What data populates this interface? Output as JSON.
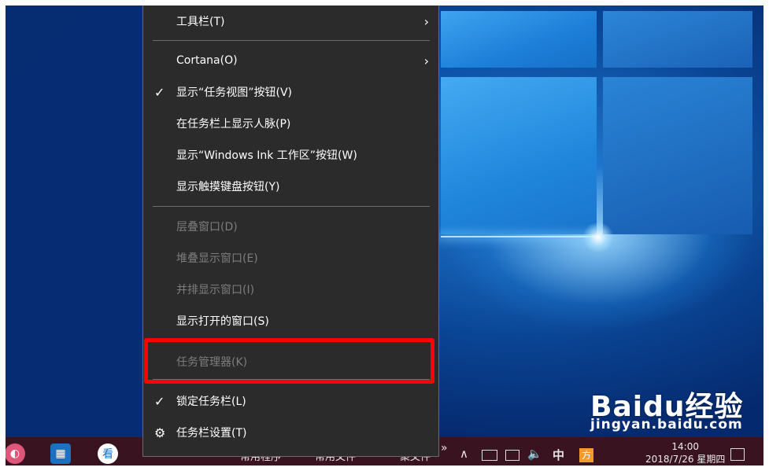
{
  "menu": {
    "items": [
      {
        "label": "工具栏(T)",
        "checked": false,
        "submenu": true,
        "disabled": false
      },
      {
        "label": "Cortana(O)",
        "checked": false,
        "submenu": true,
        "disabled": false
      },
      {
        "label": "显示“任务视图”按钮(V)",
        "checked": true,
        "submenu": false,
        "disabled": false
      },
      {
        "label": "在任务栏上显示人脉(P)",
        "checked": false,
        "submenu": false,
        "disabled": false
      },
      {
        "label": "显示“Windows Ink 工作区”按钮(W)",
        "checked": false,
        "submenu": false,
        "disabled": false
      },
      {
        "label": "显示触摸键盘按钮(Y)",
        "checked": false,
        "submenu": false,
        "disabled": false
      },
      {
        "label": "层叠窗口(D)",
        "checked": false,
        "submenu": false,
        "disabled": true
      },
      {
        "label": "堆叠显示窗口(E)",
        "checked": false,
        "submenu": false,
        "disabled": true
      },
      {
        "label": "并排显示窗口(I)",
        "checked": false,
        "submenu": false,
        "disabled": true
      },
      {
        "label": "显示打开的窗口(S)",
        "checked": false,
        "submenu": false,
        "disabled": false
      },
      {
        "label": "任务管理器(K)",
        "checked": false,
        "submenu": false,
        "disabled": true
      },
      {
        "label": "锁定任务栏(L)",
        "checked": true,
        "submenu": false,
        "disabled": false
      },
      {
        "label": "任务栏设置(T)",
        "checked": false,
        "submenu": false,
        "disabled": false,
        "icon": "gear-icon"
      }
    ],
    "check_glyph": "✓",
    "arrow_glyph": "›",
    "gear_glyph": "⚙"
  },
  "taskbar": {
    "toolbar_labels": [
      "常用程序",
      "常用文件",
      "聚文件"
    ],
    "chevron": "»",
    "tray": {
      "up_arrow": "∧",
      "ime": "中",
      "volume_icon": "volume-icon",
      "network_icon": "network-icon"
    },
    "clock": {
      "time": "14:00",
      "date": "2018/7/26 星期四"
    }
  },
  "watermark": {
    "main": "Baidu经验",
    "sub": "jingyan.baidu.com"
  },
  "colors": {
    "menu_bg": "#2b2b2b",
    "highlight": "#ff0000",
    "taskbar": "#3a1320",
    "disabled_text": "#7d7d7d"
  }
}
